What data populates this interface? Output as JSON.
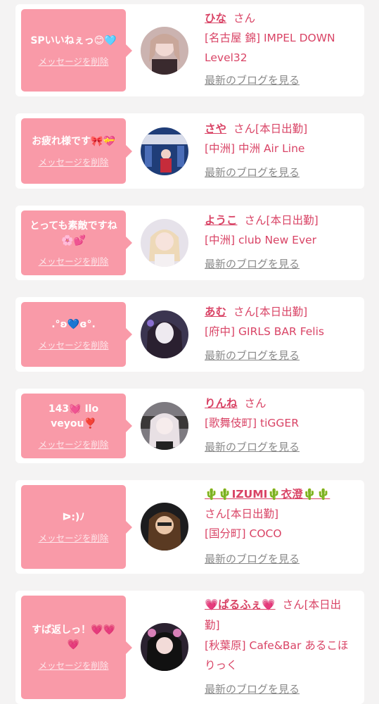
{
  "entries": [
    {
      "message": "SPいいねぇっ😊🩵",
      "delete": "メッセージを削除",
      "name": "ひな",
      "suffix": "さん",
      "shop": "[名古屋 錦] IMPEL DOWN Level32",
      "blog": "最新のブログを見る"
    },
    {
      "message": "お疲れ様です🎀💝",
      "delete": "メッセージを削除",
      "name": "さや",
      "suffix": "さん[本日出勤]",
      "shop": "[中洲] 中洲 Air Line",
      "blog": "最新のブログを見る"
    },
    {
      "message": "とっても素敵ですね🌸💕",
      "delete": "メッセージを削除",
      "name": "ようこ",
      "suffix": "さん[本日出勤]",
      "shop": "[中洲] club New Ever",
      "blog": "最新のブログを見る"
    },
    {
      "message": ".°ʚ💙ɞ°.",
      "delete": "メッセージを削除",
      "name": "あむ",
      "suffix": "さん[本日出勤]",
      "shop": "[府中] GIRLS BAR Felis",
      "blog": "最新のブログを見る"
    },
    {
      "message": "143💓 Iloveyou❣️",
      "delete": "メッセージを削除",
      "name": "りんね",
      "suffix": "さん",
      "shop": "[歌舞伎町] tiGGER",
      "blog": "最新のブログを見る"
    },
    {
      "message": "ᐅ:)ﾉ",
      "delete": "メッセージを削除",
      "name": "🌵🌵IZUMI🌵衣澄🌵🌵",
      "suffix": "さん[本日出勤]",
      "shop": "[国分町] COCO",
      "blog": "最新のブログを見る"
    },
    {
      "message": "すぱ返しっ！💗💗💗",
      "delete": "メッセージを削除",
      "name": "💗ぱるふぇ💗",
      "suffix": "さん[本日出勤]",
      "shop": "[秋葉原] Cafe&Bar あるこほりっく",
      "blog": "最新のブログを見る"
    }
  ],
  "colors": {
    "accent": "#d94466",
    "bubble": "#f99aa8",
    "background": "#f4f3f3"
  }
}
